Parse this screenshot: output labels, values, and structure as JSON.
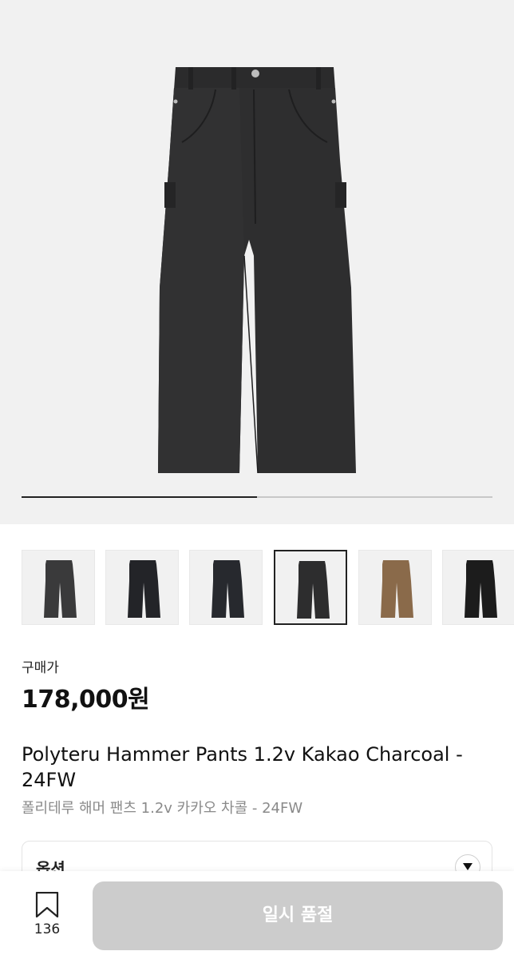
{
  "gallery": {
    "current_index": 4,
    "total": 6,
    "progress_fraction": 0.5,
    "main_pants_color": "#2e2e2f",
    "background_color": "#f1f1f1",
    "thumbnails": [
      {
        "color": "#3a3a3b",
        "selected": false
      },
      {
        "color": "#232428",
        "selected": false
      },
      {
        "color": "#27292e",
        "selected": false
      },
      {
        "color": "#2d2d2e",
        "selected": true
      },
      {
        "color": "#8a6a4a",
        "selected": false
      },
      {
        "color": "#1c1c1c",
        "selected": false
      }
    ]
  },
  "product": {
    "price_label": "구매가",
    "price": "178,000원",
    "title": "Polyteru Hammer Pants 1.2v Kakao Charcoal - 24FW",
    "subtitle": "폴리테루 해머 팬츠 1.2v 카카오 차콜 - 24FW"
  },
  "options": {
    "label": "옵션",
    "arrow_icon": "chevron-down-icon"
  },
  "bottom_bar": {
    "bookmark_icon": "bookmark-icon",
    "bookmark_count": "136",
    "buy_button_label": "일시 품절",
    "buy_button_color": "#cccccc"
  }
}
